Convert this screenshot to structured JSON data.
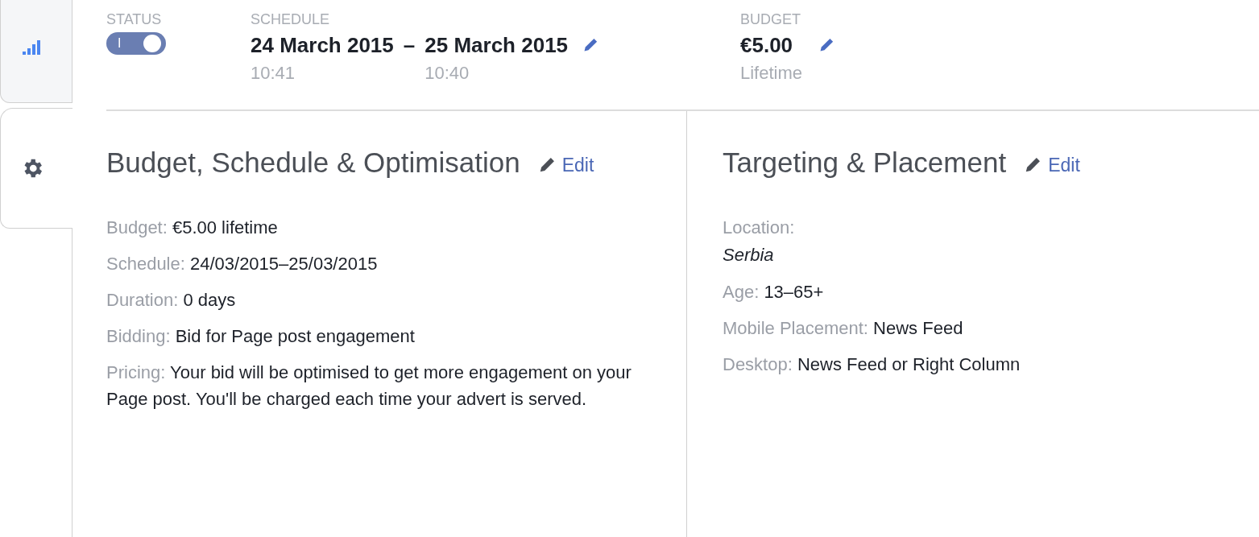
{
  "side_tabs": [
    {
      "kind": "stats",
      "selected": false
    },
    {
      "kind": "settings",
      "selected": true
    }
  ],
  "summary": {
    "status": {
      "label": "STATUS",
      "on": true,
      "switch_text": "I"
    },
    "schedule": {
      "label": "SCHEDULE",
      "start_date": "24 March 2015",
      "separator": "–",
      "end_date": "25 March 2015",
      "start_time": "10:41",
      "end_time": "10:40"
    },
    "budget": {
      "label": "BUDGET",
      "amount": "€5.00",
      "period": "Lifetime"
    }
  },
  "panels": [
    {
      "title": "Budget, Schedule & Optimisation",
      "edit": "Edit",
      "rows": [
        {
          "kind": "inline",
          "label": "Budget:",
          "value": "€5.00 lifetime"
        },
        {
          "kind": "inline",
          "label": "Schedule:",
          "value": "24/03/2015–25/03/2015"
        },
        {
          "kind": "inline",
          "label": "Duration:",
          "value": "0 days"
        },
        {
          "kind": "inline",
          "label": "Bidding:",
          "value": "Bid for Page post engagement"
        },
        {
          "kind": "inline",
          "label": "Pricing:",
          "value": "Your bid will be optimised to get more engagement on your Page post. You'll be charged each time your advert is served."
        }
      ]
    },
    {
      "title": "Targeting & Placement",
      "edit": "Edit",
      "rows": [
        {
          "kind": "stacked",
          "label": "Location:",
          "value": "Serbia"
        },
        {
          "kind": "inline",
          "label": "Age:",
          "value": "13–65+"
        },
        {
          "kind": "inline",
          "label": "Mobile Placement:",
          "value": "News Feed"
        },
        {
          "kind": "inline",
          "label": "Desktop:",
          "value": "News Feed or Right Column"
        }
      ]
    }
  ]
}
